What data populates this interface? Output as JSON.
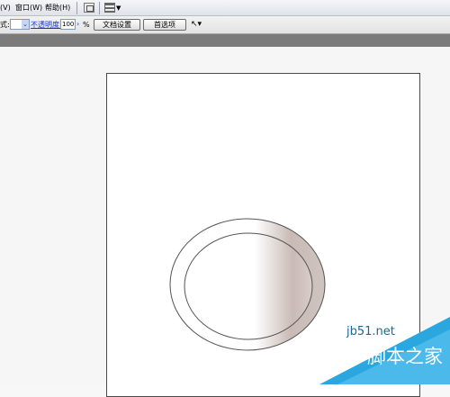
{
  "menubar": {
    "items": [
      {
        "label": "(V)"
      },
      {
        "label": "窗口(W)"
      },
      {
        "label": "帮助(H)"
      }
    ],
    "icons": [
      "view-mode-icon",
      "layout-grid-icon",
      "dropdown-arrow-icon"
    ]
  },
  "options_bar": {
    "style_label": "式:",
    "opacity_label": "不透明度:",
    "opacity_value": "100",
    "percent": "%",
    "doc_settings_button": "文档设置",
    "preferences_button": "首选项"
  },
  "artwork": {
    "shape": "ellipse-with-ring",
    "fill_colors": [
      "#ffffff",
      "#c9bab5"
    ],
    "stroke_color": "#555555"
  },
  "watermark": {
    "site": "jb51.net",
    "name": "脚本之家"
  }
}
